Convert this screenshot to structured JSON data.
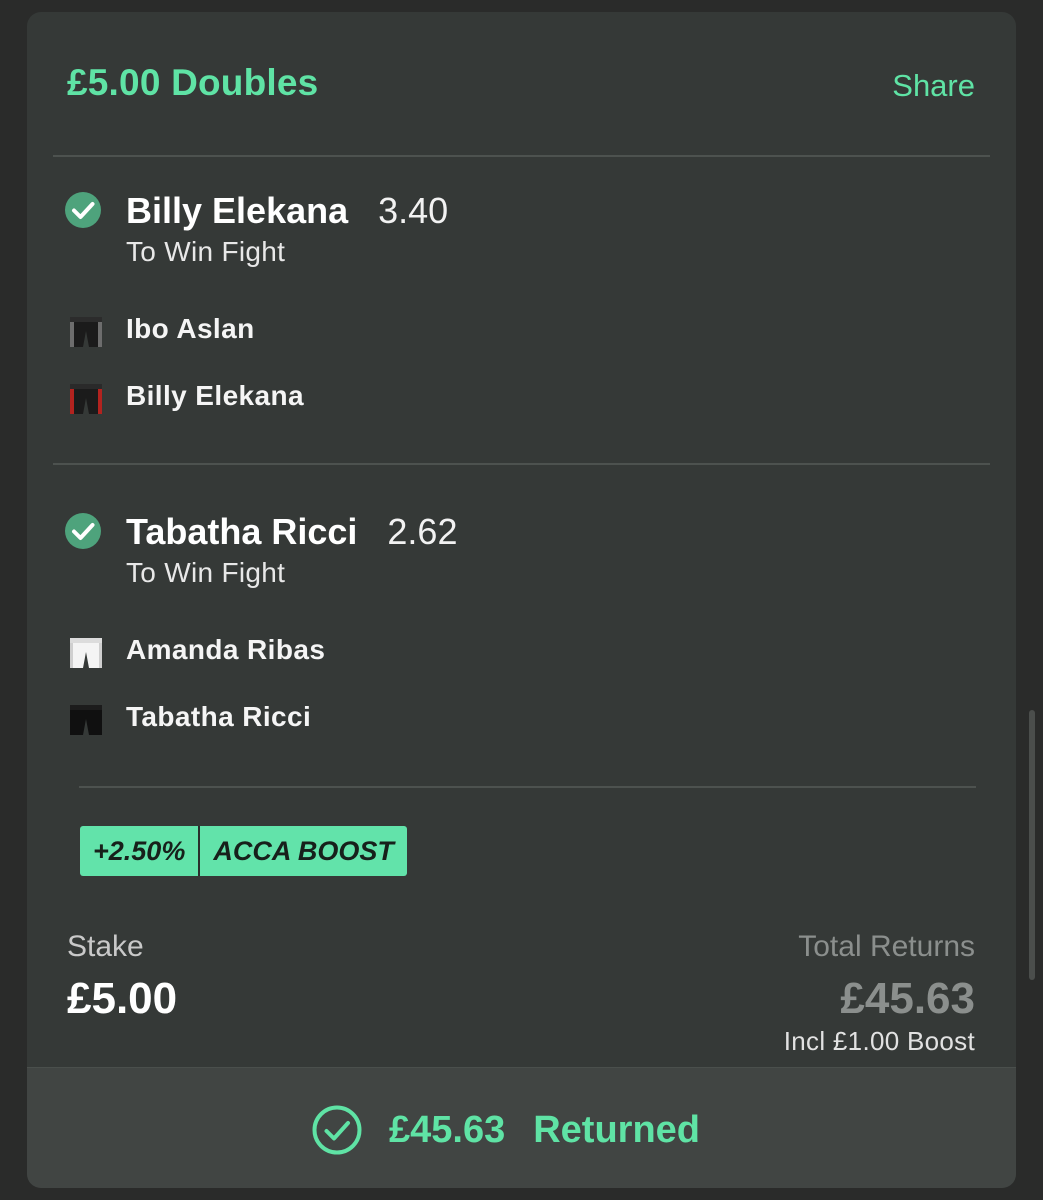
{
  "bet": {
    "title": "£5.00 Doubles",
    "share_label": "Share"
  },
  "selections": [
    {
      "name": "Billy Elekana",
      "odds": "3.40",
      "market": "To Win Fight",
      "status_icon": "check-circle-icon",
      "fighters": [
        {
          "name": "Ibo Aslan",
          "shorts_icon": "black-shorts-grey-stripe-icon"
        },
        {
          "name": "Billy Elekana",
          "shorts_icon": "black-shorts-red-stripe-icon"
        }
      ]
    },
    {
      "name": "Tabatha Ricci",
      "odds": "2.62",
      "market": "To Win Fight",
      "status_icon": "check-circle-icon",
      "fighters": [
        {
          "name": "Amanda Ribas",
          "shorts_icon": "white-shorts-icon"
        },
        {
          "name": "Tabatha Ricci",
          "shorts_icon": "black-shorts-icon"
        }
      ]
    }
  ],
  "boost": {
    "percent": "+2.50%",
    "label": "ACCA BOOST"
  },
  "stake": {
    "label": "Stake",
    "value": "£5.00"
  },
  "returns": {
    "label": "Total Returns",
    "value": "£45.63",
    "note": "Incl £1.00 Boost"
  },
  "result": {
    "amount": "£45.63",
    "status": "Returned",
    "icon": "check-circle-outline-icon"
  },
  "colors": {
    "accent": "#5fe3a5",
    "card": "#353937",
    "background": "#2a2b2a",
    "footer": "#414543",
    "check": "#4ea37c"
  }
}
